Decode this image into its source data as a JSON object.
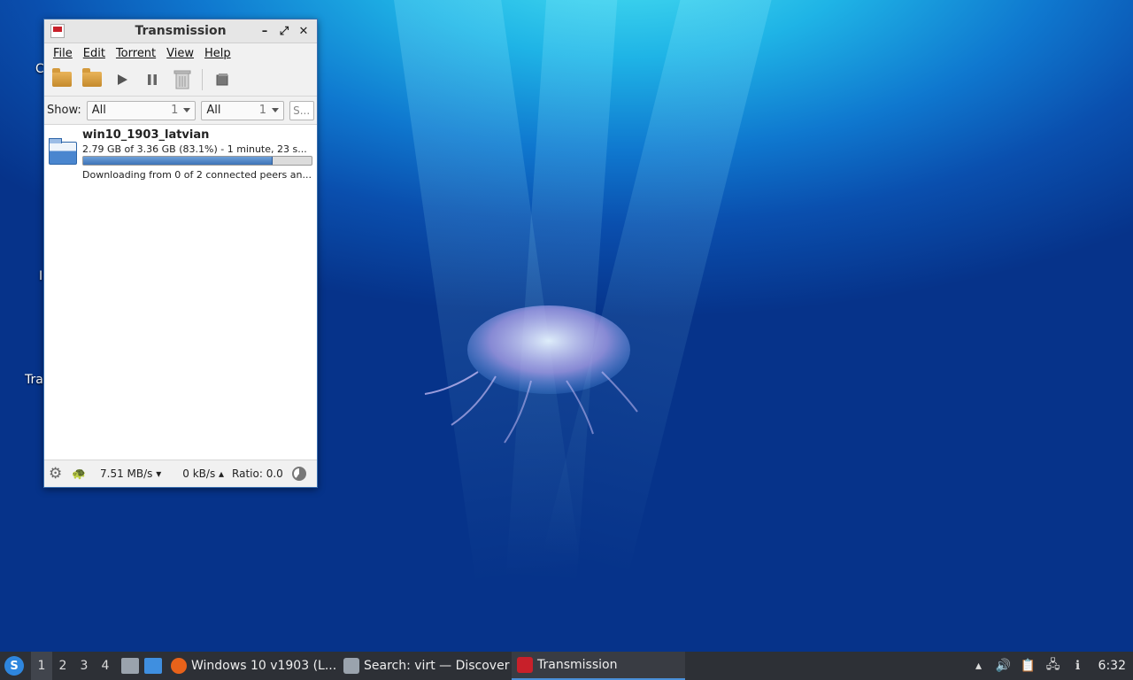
{
  "window": {
    "title": "Transmission",
    "minimize_glyph": "–",
    "maximize_glyph": "⤢",
    "close_glyph": "✕"
  },
  "menu": [
    "File",
    "Edit",
    "Torrent",
    "View",
    "Help"
  ],
  "toolbar": {
    "icons": [
      "open-folder-icon",
      "open-folder-icon",
      "play-icon",
      "pause-icon",
      "trash-icon",
      "properties-icon"
    ]
  },
  "filter": {
    "show_label": "Show:",
    "category": {
      "value": "All",
      "count": "1"
    },
    "tracker": {
      "value": "All",
      "count": "1"
    },
    "search_placeholder": "S..."
  },
  "torrents": [
    {
      "name": "win10_1903_latvian",
      "progress_text": "2.79 GB of 3.36 GB (83.1%) - 1 minute, 23 s...",
      "progress_pct": 83.1,
      "status": "Downloading from 0 of 2 connected peers an..."
    }
  ],
  "statusbar": {
    "download": "7.51 MB/s ▾",
    "upload": "0 kB/s ▴",
    "ratio": "Ratio: 0.0"
  },
  "desktop_labels": [
    "C",
    "I",
    "Tra"
  ],
  "taskbar": {
    "workspaces": [
      "1",
      "2",
      "3",
      "4"
    ],
    "active_workspace": 0,
    "tasks": [
      {
        "label": "Windows 10 v1903 (L...",
        "icon": "firefox-icon",
        "color": "#e8621a"
      },
      {
        "label": "Search: virt — Discover",
        "icon": "discover-icon",
        "color": "#9aa3ad"
      },
      {
        "label": "Transmission",
        "icon": "transmission-icon",
        "color": "#c8202a"
      }
    ],
    "clock": "6:32"
  },
  "colors": {
    "progress": "#4a86cf",
    "taskbar": "#2d3036",
    "accent": "#4a90d9"
  }
}
